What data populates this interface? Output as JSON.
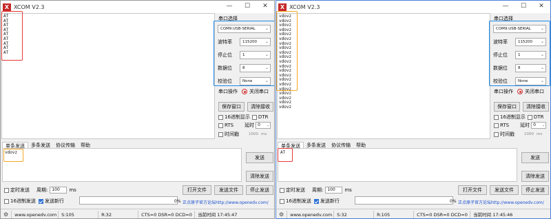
{
  "windows": [
    {
      "id": "left",
      "title": "XCOM V2.3",
      "app_icon": "X",
      "receive_lines": [
        "AT",
        "AT",
        "AT",
        "AT",
        "AT",
        "AT",
        "AT",
        "AT",
        "AT"
      ],
      "send_text": "vdovz",
      "status": {
        "s": "S:105",
        "r": "R:32",
        "lines": "CTS=0 DSR=0 DCD=0",
        "time": "当前时间 17:45:47"
      }
    },
    {
      "id": "right",
      "title": "XCOM V2.3",
      "app_icon": "X",
      "receive_lines": [
        "vdovz",
        "vdovz",
        "vdovz",
        "vdovz",
        "vdovz",
        "vdovz",
        "vdovz",
        "vdovz",
        "vdovz",
        "vdovz",
        "vdovz",
        "vdovz",
        "vdovz",
        "vdovz",
        "vdovz",
        "vdovz",
        "vdovz",
        "vdovz",
        "vdovz",
        "vdovz",
        "vdovz"
      ],
      "send_text": "AT",
      "status": {
        "s": "S:32",
        "r": "R:105",
        "lines": "CTS=0 DSR=0 DCD=0",
        "time": "当前时间 17:45:46"
      }
    }
  ],
  "common": {
    "title_buttons": {
      "minimize": "—",
      "maximize": "☐",
      "close": "✕"
    },
    "serial_select_label": "串口选择",
    "port_value": "COM9:USB-SERIAL",
    "baud_label": "波特率",
    "baud_value": "115200",
    "stopbit_label": "停止位",
    "stopbit_value": "1",
    "databit_label": "数据位",
    "databit_value": "8",
    "parity_label": "校验位",
    "parity_value": "None",
    "port_op_label": "串口操作",
    "close_port_label": "关闭串口",
    "save_window_label": "保存窗口",
    "clear_recv_label": "清除接收",
    "hex_display_label": "16进制显示",
    "dtr_label": "DTR",
    "rts_label": "RTS",
    "delay_label": "延时",
    "delay_value": "0",
    "timestamp_label": "时间戳",
    "timestamp_value": "1000",
    "ms_label": "ms",
    "tabs": [
      "单条发送",
      "多条发送",
      "协议传输",
      "帮助"
    ],
    "send_button": "发送",
    "clear_send_button": "清除发送",
    "timed_send_label": "定时发送",
    "period_label": "周期:",
    "period_value": "100",
    "period_unit": "ms",
    "open_file_button": "打开文件",
    "send_file_button": "发送文件",
    "stop_send_button": "停止发送",
    "hex_send_label": "16进制发送",
    "send_newline_label": "发送新行",
    "progress_value": "0%",
    "forum_link": "正点原子官方论坛http://www.openedv.com/",
    "website": "www.openedv.com",
    "icons": {
      "gear": "gear-icon",
      "app": "xcom-app-icon"
    }
  },
  "highlight_colors": {
    "red": "#e53935",
    "orange": "#f5a623",
    "blue": "#1e88e5"
  }
}
